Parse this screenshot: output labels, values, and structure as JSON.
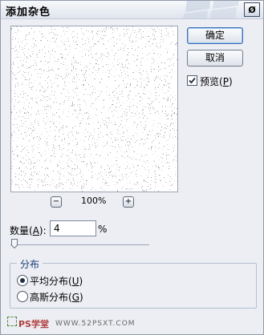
{
  "title": "添加杂色",
  "close_glyph": "Ø",
  "preview": {
    "zoom_level": "100%",
    "zoom_out": "−",
    "zoom_in": "+"
  },
  "buttons": {
    "ok": "确定",
    "cancel": "取消"
  },
  "preview_checkbox": {
    "label_pre": "预览(",
    "mnemonic": "P",
    "label_post": ")",
    "checked": true
  },
  "amount": {
    "label_pre": "数量(",
    "mnemonic": "A",
    "label_post": "):",
    "value": "4",
    "unit": "%"
  },
  "slider": {
    "value": 4
  },
  "distribution": {
    "title": "分布",
    "options": [
      {
        "label_pre": "平均分布(",
        "mnemonic": "U",
        "label_post": ")",
        "selected": true
      },
      {
        "label_pre": "高斯分布(",
        "mnemonic": "G",
        "label_post": ")",
        "selected": false
      }
    ]
  },
  "watermark": {
    "text": "PS学堂",
    "site": "WWW.52PSXT.COM"
  }
}
